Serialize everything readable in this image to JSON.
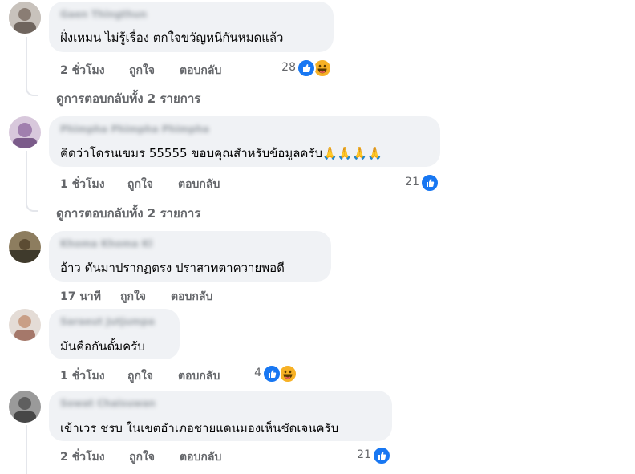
{
  "comments": [
    {
      "author": "Gaen Thingthun",
      "text": "ฝั่งเหมน ไม่รู้เรื่อง ตกใจขวัญหนีกันหมดแล้ว",
      "time": "2 ชั่วโมง",
      "like_label": "ถูกใจ",
      "reply_label": "ตอบกลับ",
      "reaction_count": "28",
      "reaction_icons": [
        "like-icon",
        "haha-icon"
      ],
      "view_replies": "ดูการตอบกลับทั้ง 2 รายการ"
    },
    {
      "author": "Phimpha Phimpha Phimpha",
      "text": "คิดว่าโดรนเขมร 55555 ขอบคุณสำหรับข้อมูลครับ🙏🙏🙏🙏",
      "time": "1 ชั่วโมง",
      "like_label": "ถูกใจ",
      "reply_label": "ตอบกลับ",
      "reaction_count": "21",
      "reaction_icons": [
        "like-icon"
      ],
      "view_replies": "ดูการตอบกลับทั้ง 2 รายการ"
    },
    {
      "author": "Khoma Khoma Kl",
      "text": "อ้าว ดันมาปรากฏตรง ปราสาทตาควายพอดี",
      "time": "17 นาที",
      "like_label": "ถูกใจ",
      "reply_label": "ตอบกลับ"
    },
    {
      "author": "Saraeut Jutjumpa",
      "text": "มันคือกันดั้มครับ",
      "time": "1 ชั่วโมง",
      "like_label": "ถูกใจ",
      "reply_label": "ตอบกลับ",
      "reaction_count": "4",
      "reaction_icons": [
        "like-icon",
        "haha-icon"
      ]
    },
    {
      "author": "Sowat Chaisuwan",
      "text": "เข้าเวร ชรบ ในเขตอำเภอชายแดนมองเห็นชัดเจนครับ",
      "time": "2 ชั่วโมง",
      "like_label": "ถูกใจ",
      "reply_label": "ตอบกลับ",
      "reaction_count": "21",
      "reaction_icons": [
        "like-icon"
      ]
    }
  ],
  "colors": {
    "bubble": "#f0f2f5",
    "meta_text": "#65676b",
    "like_blue": "#1877f2",
    "haha_yellow": "#f7b125",
    "thread_line": "#e4e6eb"
  }
}
